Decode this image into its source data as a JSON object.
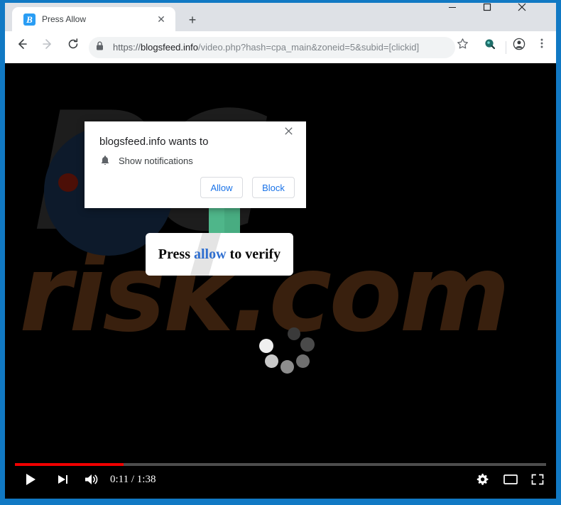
{
  "window": {
    "frame_color": "#1179c4",
    "controls": {
      "minimize": "—",
      "maximize": "☐",
      "close": "✕"
    }
  },
  "browser": {
    "tab": {
      "title": "Press Allow",
      "favicon_letter": "B",
      "favicon_color": "#2a9df4",
      "close_label": "✕"
    },
    "new_tab_label": "+",
    "nav": {
      "back": "←",
      "forward": "→",
      "reload": "⟳"
    },
    "omnibox": {
      "lock_icon": "🔒",
      "scheme": "https://",
      "host": "blogsfeed.info",
      "path": "/video.php?hash=cpa_main&zoneid=5&subid=[clickid]",
      "full_url": "https://blogsfeed.info/video.php?hash=cpa_main&zoneid=5&subid=[clickid]"
    },
    "toolbar_icons": {
      "bookmark": "☆",
      "extension": "extension-icon",
      "profile": "profile-icon",
      "menu": "⋮"
    }
  },
  "permission_dialog": {
    "title": "blogsfeed.info wants to",
    "bell_icon": "🔔",
    "permission": "Show notifications",
    "allow_label": "Allow",
    "block_label": "Block",
    "close_label": "✕",
    "accent_color": "#1a73e8"
  },
  "page": {
    "watermark_top": "PC",
    "watermark_bottom": "risk.com",
    "watermark_top_color": "#1d1d1d",
    "watermark_bottom_color": "#39200e",
    "arrow_color": "#4fb68a",
    "banner": {
      "text_before": "Press ",
      "highlight": "allow",
      "text_after": " to verify",
      "highlight_color": "#2f6fd0"
    }
  },
  "video_controls": {
    "play_label": "play",
    "next_label": "next",
    "volume_label": "volume",
    "current_time": "0:11",
    "duration": "1:38",
    "time_display": "0:11 / 1:38",
    "progress_percent": 20.4,
    "progress_color": "#f00000",
    "settings_label": "settings",
    "miniplayer_label": "miniplayer",
    "fullscreen_label": "fullscreen"
  }
}
